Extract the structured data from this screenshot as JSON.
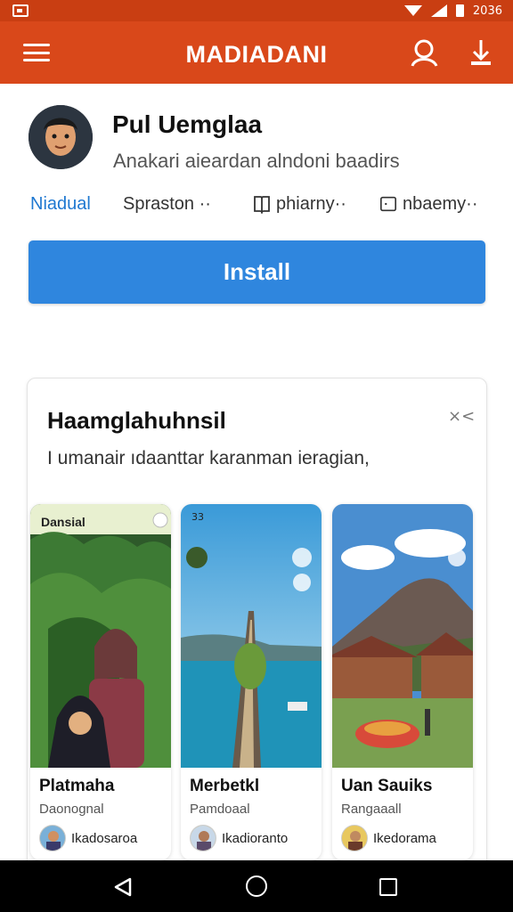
{
  "status_bar": {
    "time": "2036"
  },
  "app_bar": {
    "title": "MADIADANI"
  },
  "app": {
    "name": "Pul Uemglaa",
    "subtitle": "Anakari aieardan alndoni baadirs",
    "chips": [
      {
        "label": "Niadual",
        "icon": ""
      },
      {
        "label": "Spraston ··",
        "icon": "sparkle-icon"
      },
      {
        "label": "phiarny··",
        "icon": "book-icon"
      },
      {
        "label": "nbaemy··",
        "icon": "chat-icon"
      }
    ],
    "install_label": "Install"
  },
  "recommendation": {
    "title": "Haamglahuhnsil",
    "close_icon": "×<",
    "description": "I umanair ıdaanttar karanman ieragian,",
    "cards": [
      {
        "label": "Dansial",
        "title": "Platmaha",
        "subtitle": "Daonognal",
        "author": "Ikadosaroa"
      },
      {
        "time": "33",
        "title": "Merbetkl",
        "subtitle": "Pamdoaal",
        "author": "Ikadioranto"
      },
      {
        "title": "Uan Sauiks",
        "subtitle": "Rangaaall",
        "author": "Ikedorama"
      }
    ]
  },
  "colors": {
    "app_bar": "#d9481a",
    "status_bar": "#c93e12",
    "install": "#2f86de",
    "accent_chip": "#1f78d1"
  }
}
